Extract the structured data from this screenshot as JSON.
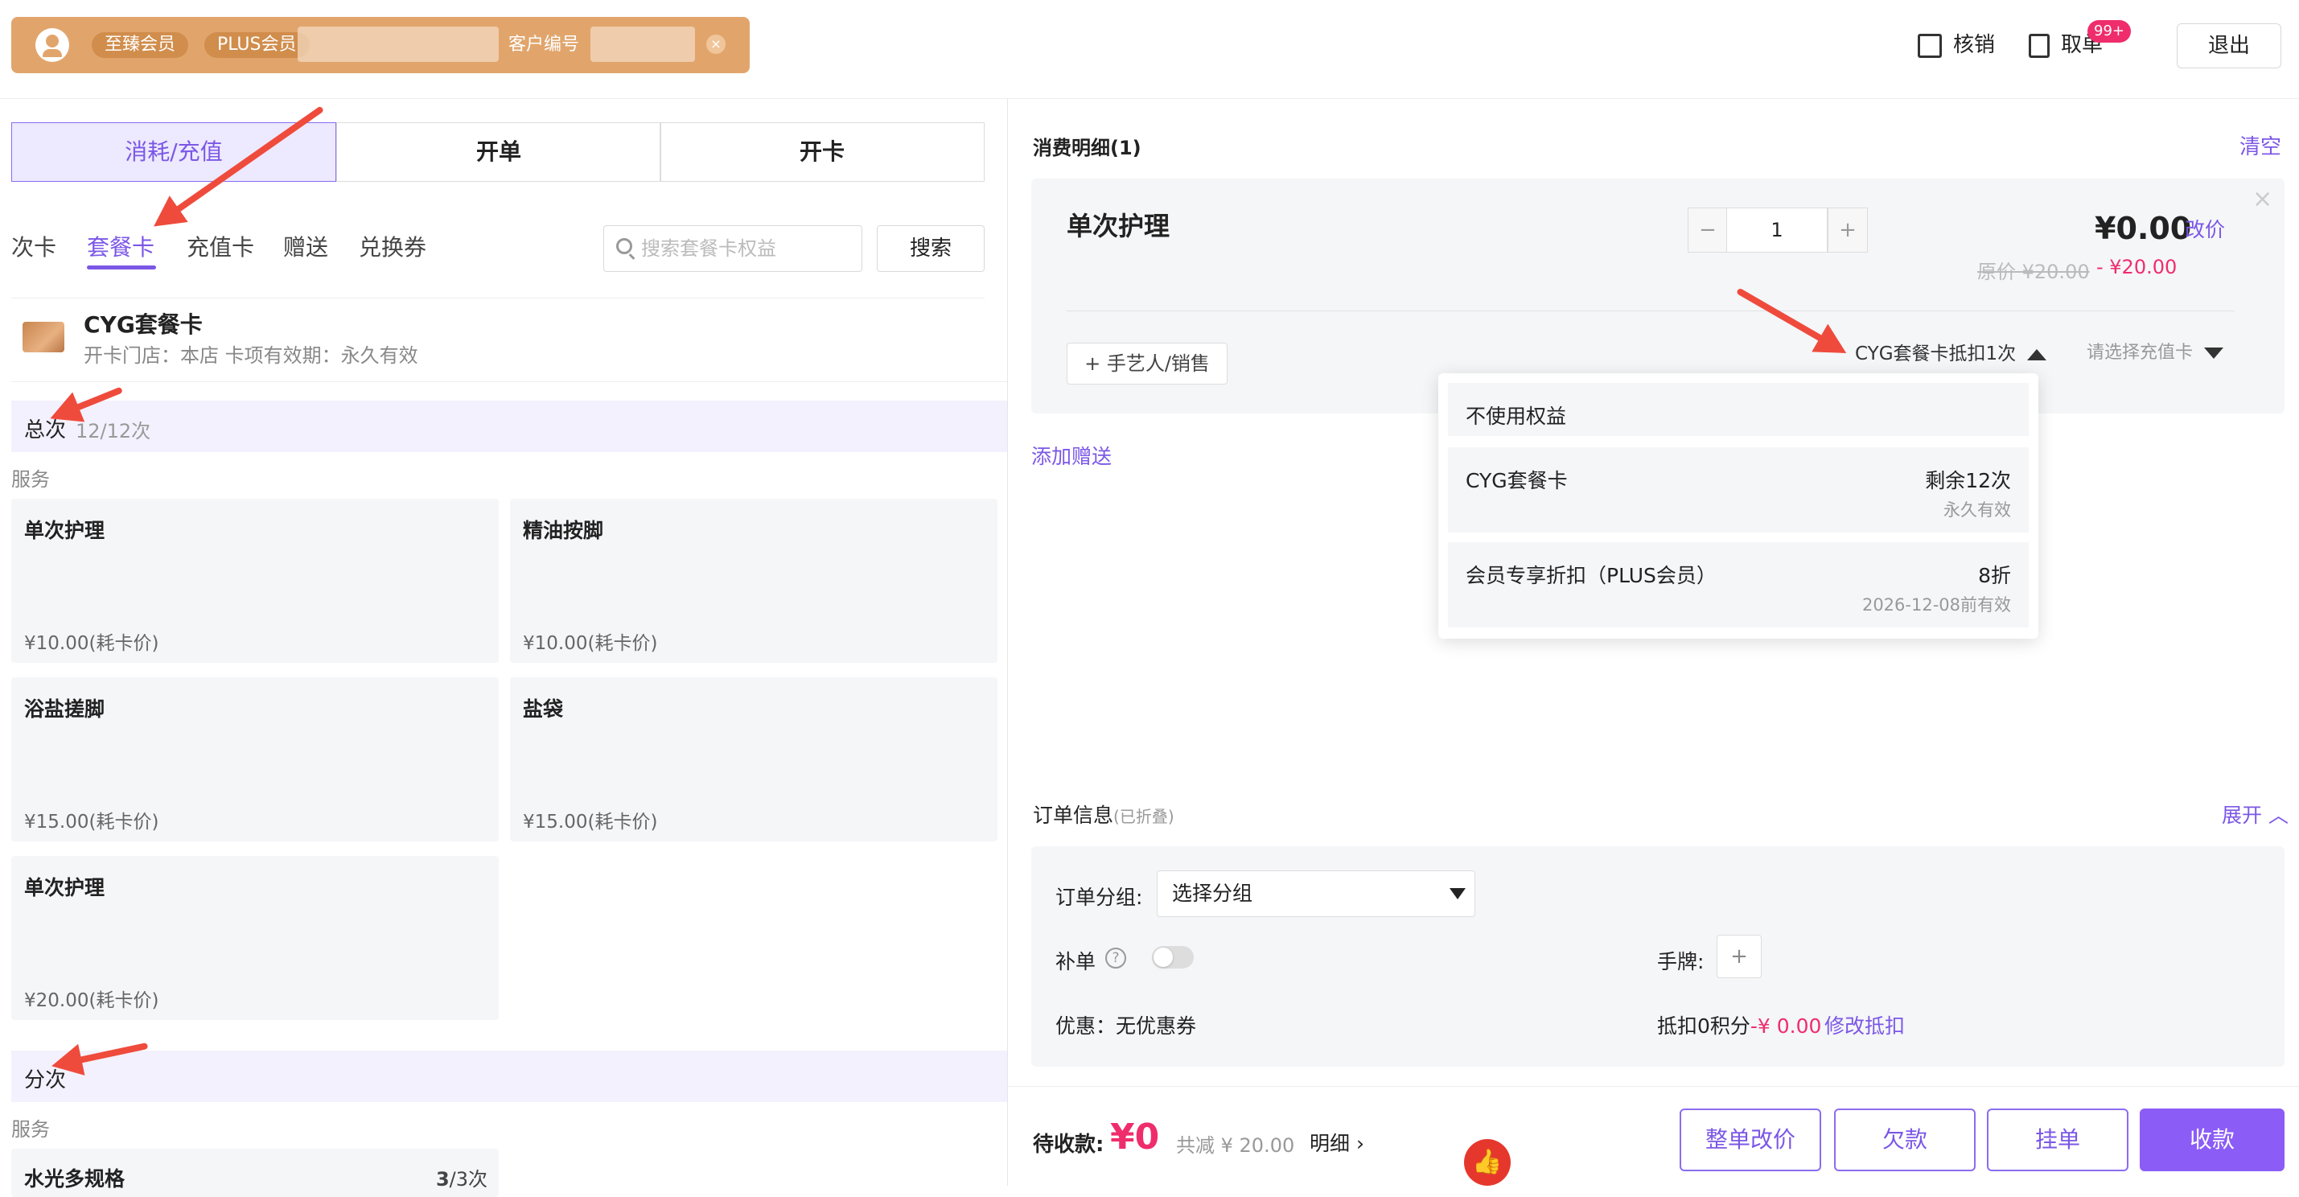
{
  "header": {
    "tags": [
      "至臻会员",
      "PLUS会员"
    ],
    "customer_no_label": "客户编号",
    "actions": {
      "verify": "核销",
      "take_order": "取单",
      "take_order_badge": "99+",
      "logout": "退出"
    }
  },
  "left": {
    "main_tabs": [
      "消耗/充值",
      "开单",
      "开卡"
    ],
    "sub_tabs": [
      "次卡",
      "套餐卡",
      "充值卡",
      "赠送",
      "兑换券"
    ],
    "active_sub_tab": "套餐卡",
    "search": {
      "placeholder": "搜索套餐卡权益",
      "button": "搜索"
    },
    "card": {
      "name": "CYG套餐卡",
      "sub": "开卡门店：本店  卡项有效期：永久有效"
    },
    "sections": [
      {
        "title": "总次",
        "subtitle": "12/12次",
        "service_label": "服务",
        "items": [
          {
            "name": "单次护理",
            "price": "¥10.00(耗卡价)"
          },
          {
            "name": "精油按脚",
            "price": "¥10.00(耗卡价)"
          },
          {
            "name": "浴盐搓脚",
            "price": "¥15.00(耗卡价)"
          },
          {
            "name": "盐袋",
            "price": "¥15.00(耗卡价)"
          },
          {
            "name": "单次护理",
            "price": "¥20.00(耗卡价)"
          }
        ]
      },
      {
        "title": "分次",
        "service_label": "服务",
        "items": [
          {
            "name": "水光多规格",
            "count_used": "3",
            "count_total": "/3次"
          }
        ]
      }
    ]
  },
  "right": {
    "title": "消费明细(1)",
    "clear": "清空",
    "item": {
      "name": "单次护理",
      "qty": "1",
      "price": "¥0.00",
      "edit_price": "改价",
      "original": "原价 ¥20.00",
      "discount": "- ¥20.00",
      "artisan_btn": "+ 手艺人/销售",
      "benefit_select": "CYG套餐卡抵扣1次",
      "recharge_select": "请选择充值卡"
    },
    "benefit_options": [
      {
        "name": "不使用权益"
      },
      {
        "name": "CYG套餐卡",
        "value": "剩余12次",
        "sub": "永久有效"
      },
      {
        "name": "会员专享折扣（PLUS会员）",
        "value": "8折",
        "sub": "2026-12-08前有效"
      }
    ],
    "add_gift": "添加赠送",
    "order_info": {
      "title": "订单信息",
      "collapsed_note": "(已折叠)",
      "expand": "展开",
      "group_label": "订单分组:",
      "group_value": "选择分组",
      "supplement_label": "补单",
      "tag_label": "手牌:",
      "coupon_label": "优惠：无优惠券",
      "points_label": "抵扣0积分",
      "points_value": "-¥ 0.00",
      "points_edit": "修改抵扣"
    },
    "footer": {
      "due_label": "待收款:",
      "due_value": "¥0",
      "saved": "共减 ¥ 20.00",
      "detail": "明细",
      "buttons": [
        "整单改价",
        "欠款",
        "挂单",
        "收款"
      ]
    }
  },
  "colors": {
    "accent": "#7b57e6",
    "member_bar": "#e1a56c",
    "price_red": "#ef2d6c",
    "annotation_arrow": "#ef4b3c"
  }
}
